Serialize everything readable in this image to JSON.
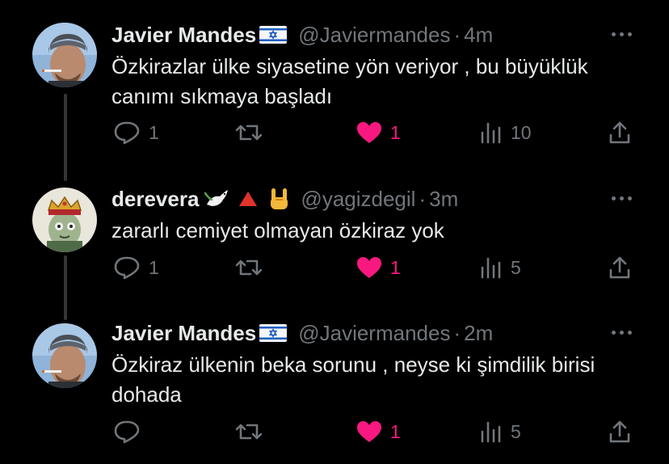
{
  "tweets": [
    {
      "author": "Javier Mandes",
      "flag": "israel-flag",
      "handle": "@Javiermandes",
      "separator": "·",
      "time": "4m",
      "text": "Özkirazlar ülke siyasetine yön veriyor , bu büyüklük canımı sıkmaya başladı",
      "replies": "1",
      "retweets": "",
      "likes": "1",
      "liked": true,
      "views": "10"
    },
    {
      "author": "derevera",
      "emojis": [
        "dove-emoji",
        "red-triangle-emoji",
        "rock-hand-emoji"
      ],
      "handle": "@yagizdegil",
      "separator": "·",
      "time": "3m",
      "text": "zararlı cemiyet olmayan özkiraz yok",
      "replies": "1",
      "retweets": "",
      "likes": "1",
      "liked": true,
      "views": "5"
    },
    {
      "author": "Javier Mandes",
      "flag": "israel-flag",
      "handle": "@Javiermandes",
      "separator": "·",
      "time": "2m",
      "text": "Özkiraz ülkenin beka sorunu , neyse ki şimdilik birisi dohada",
      "replies": "",
      "retweets": "",
      "likes": "1",
      "liked": true,
      "views": "5"
    }
  ],
  "colors": {
    "background": "#000000",
    "text": "#e7e9ea",
    "muted": "#71767b",
    "like": "#f91880",
    "thread_line": "#333639"
  }
}
